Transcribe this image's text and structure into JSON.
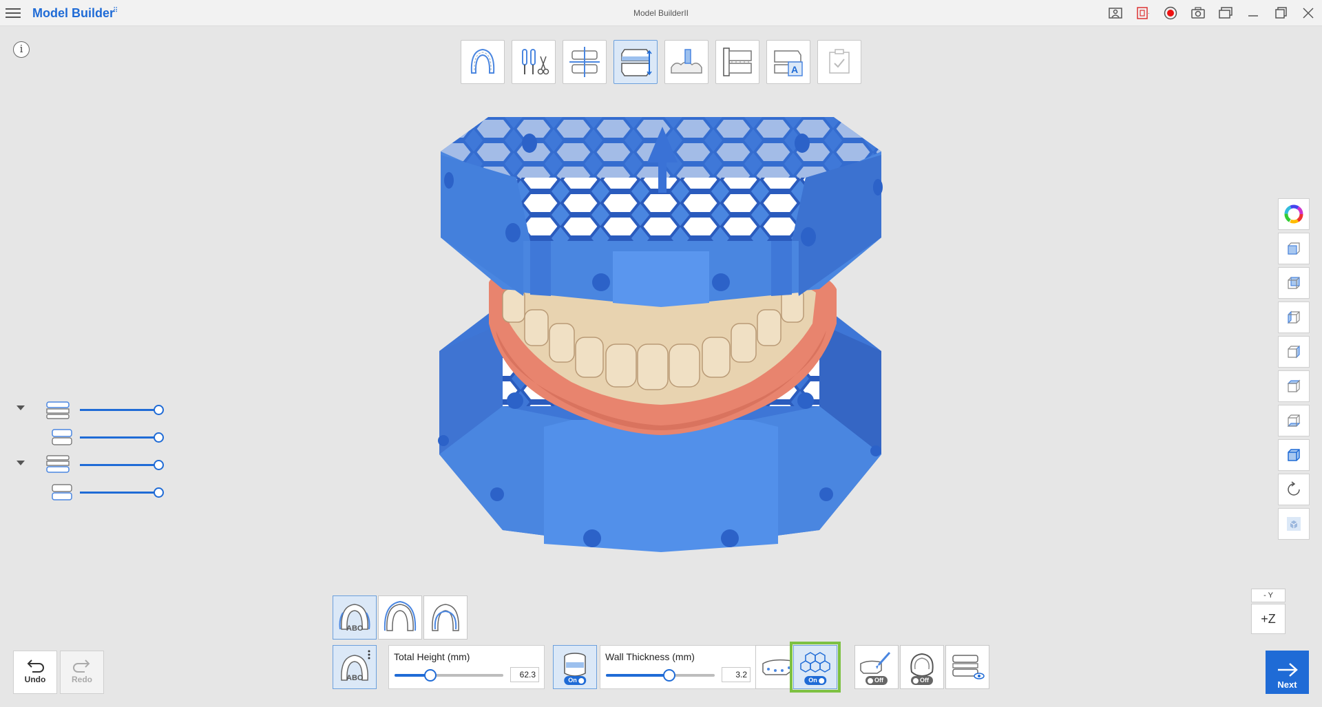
{
  "titlebar": {
    "app_title": "Model Builder",
    "app_badge": "⠿",
    "window_title": "Model BuilderII",
    "icons": [
      "scan-info-icon",
      "screen-record-icon",
      "record-icon",
      "camera-icon",
      "screenshot-gallery-icon",
      "minimize-icon",
      "maximize-icon",
      "close-icon"
    ]
  },
  "info": {
    "label": "i"
  },
  "steps": [
    {
      "name": "arch-select",
      "active": false
    },
    {
      "name": "tools-trim",
      "active": false
    },
    {
      "name": "occlusal-plane",
      "active": false
    },
    {
      "name": "base-height",
      "active": true
    },
    {
      "name": "die-pins",
      "active": false
    },
    {
      "name": "articulator",
      "active": false
    },
    {
      "name": "labeling",
      "active": false
    },
    {
      "name": "complete",
      "active": false
    }
  ],
  "undo": {
    "label": "Undo"
  },
  "redo": {
    "label": "Redo"
  },
  "next": {
    "label": "Next"
  },
  "axis": {
    "top": "- Y",
    "main": "+Z"
  },
  "panel": {
    "total_height": {
      "label": "Total Height (mm)",
      "value": "62.3",
      "fraction": 0.33
    },
    "wall_thickness": {
      "label": "Wall Thickness (mm)",
      "value": "3.2",
      "fraction": 0.58
    },
    "hollow_toggle": "On",
    "honeycomb_toggle": "On",
    "brush_toggle": "Off",
    "outline_toggle": "Off"
  },
  "colors": {
    "accent": "#1f6bd6",
    "base_blue": "#4a86e0",
    "highlight": "#7dc142",
    "gum": "#e8846e"
  }
}
